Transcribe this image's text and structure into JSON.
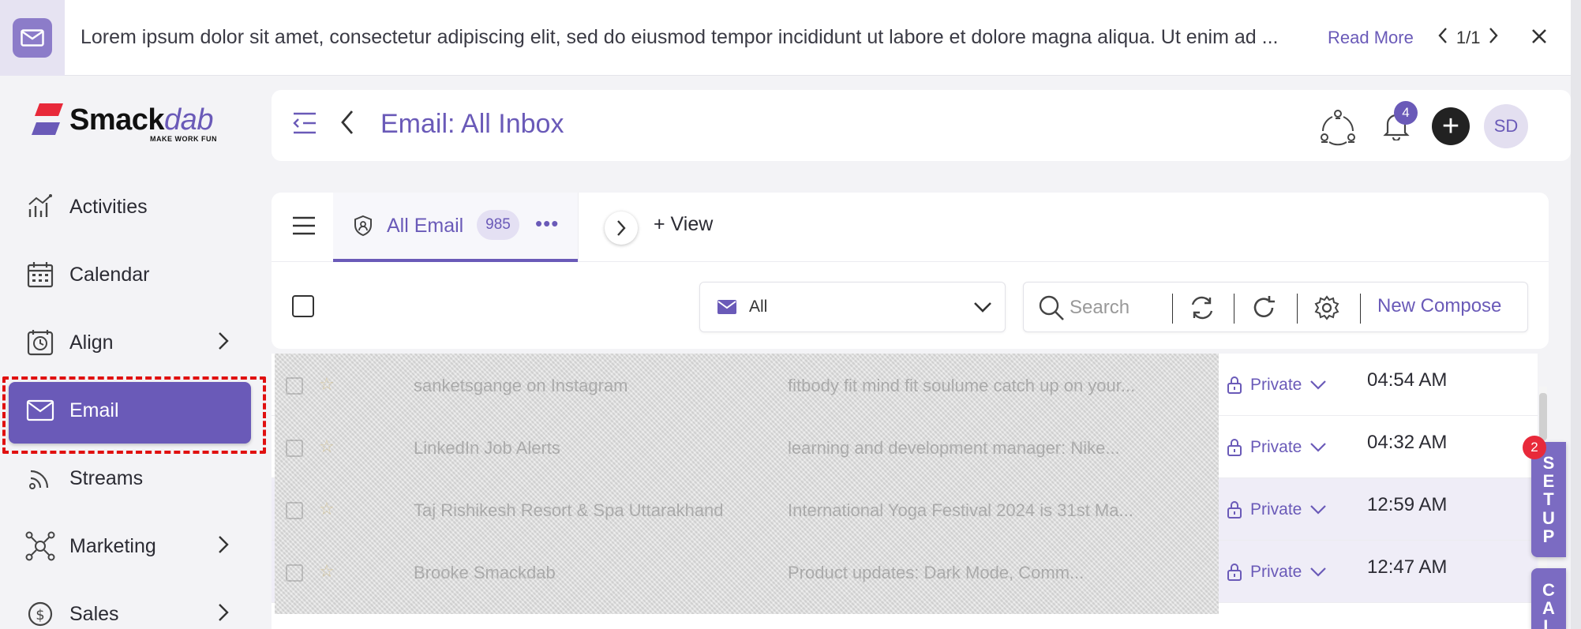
{
  "announcement": {
    "text": "Lorem ipsum dolor sit amet, consectetur adipiscing elit, sed do eiusmod tempor incididunt ut labore et dolore magna aliqua. Ut enim ad ...",
    "read_more": "Read More",
    "pager": "1/1"
  },
  "logo": {
    "brand_main": "Smack",
    "brand_accent": "dab",
    "tagline": "MAKE WORK FUN"
  },
  "sidebar": {
    "items": [
      {
        "label": "Activities",
        "icon": "chart-icon"
      },
      {
        "label": "Calendar",
        "icon": "calendar-icon"
      },
      {
        "label": "Align",
        "icon": "clock-icon",
        "has_children": true
      },
      {
        "label": "Email",
        "icon": "mail-icon",
        "active": true
      },
      {
        "label": "Streams",
        "icon": "rss-icon"
      },
      {
        "label": "Marketing",
        "icon": "network-icon",
        "has_children": true
      },
      {
        "label": "Sales",
        "icon": "dollar-icon",
        "has_children": true
      }
    ]
  },
  "header": {
    "title": "Email: All Inbox",
    "notification_count": "4",
    "plus": "+",
    "avatar_initials": "SD"
  },
  "tabs": {
    "all_email_label": "All Email",
    "all_email_count": "985",
    "more": "•••",
    "add_view": "+ View"
  },
  "toolbar": {
    "filter_value": "All",
    "search_placeholder": "Search",
    "new_compose": "New Compose"
  },
  "emails": [
    {
      "from": "sanketsgange on Instagram",
      "subject": "fitbody fit mind fit soulume catch up on your...",
      "privacy": "Private",
      "time": "04:54 AM"
    },
    {
      "from": "LinkedIn Job Alerts",
      "subject": "learning and development manager: Nike...",
      "privacy": "Private",
      "time": "04:32 AM"
    },
    {
      "from": "Taj Rishikesh Resort & Spa Uttarakhand",
      "subject": "International Yoga Festival 2024 is 31st Ma...",
      "privacy": "Private",
      "time": "12:59 AM"
    },
    {
      "from": "Brooke Smackdab",
      "subject": "Product updates: Dark Mode, Comm...",
      "privacy": "Private",
      "time": "12:47 AM"
    }
  ],
  "edge_tabs": {
    "setup": [
      "S",
      "E",
      "T",
      "U",
      "P"
    ],
    "setup_badge": "2",
    "call": [
      "C",
      "A",
      "L"
    ]
  },
  "colors": {
    "accent": "#6a5ab8",
    "highlight": "#e01010",
    "badge": "#e8293a"
  }
}
